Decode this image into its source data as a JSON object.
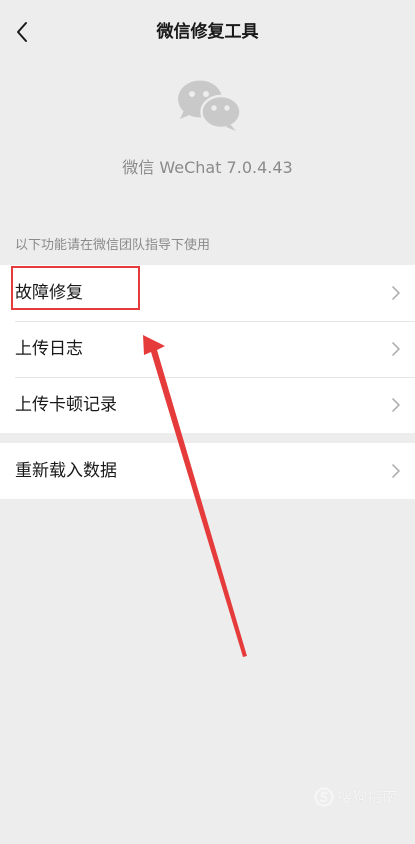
{
  "nav": {
    "title": "微信修复工具",
    "back_icon": "chevron-left-icon"
  },
  "header": {
    "logo_icon": "wechat-logo-icon",
    "version": "微信 WeChat 7.0.4.43"
  },
  "section_hint": "以下功能请在微信团队指导下使用",
  "group_a": [
    {
      "label": "故障修复"
    },
    {
      "label": "上传日志"
    },
    {
      "label": "上传卡顿记录"
    }
  ],
  "group_b": [
    {
      "label": "重新载入数据"
    }
  ],
  "annotation": {
    "color": "#e63b3b",
    "highlighted_item": "故障修复"
  },
  "watermark": {
    "text": "搜狗指南",
    "icon": "sogou-logo-icon"
  },
  "colors": {
    "background": "#ededed",
    "cell_background": "#ffffff",
    "secondary_text": "#8a8a8a",
    "chevron": "#b2b2b2"
  }
}
